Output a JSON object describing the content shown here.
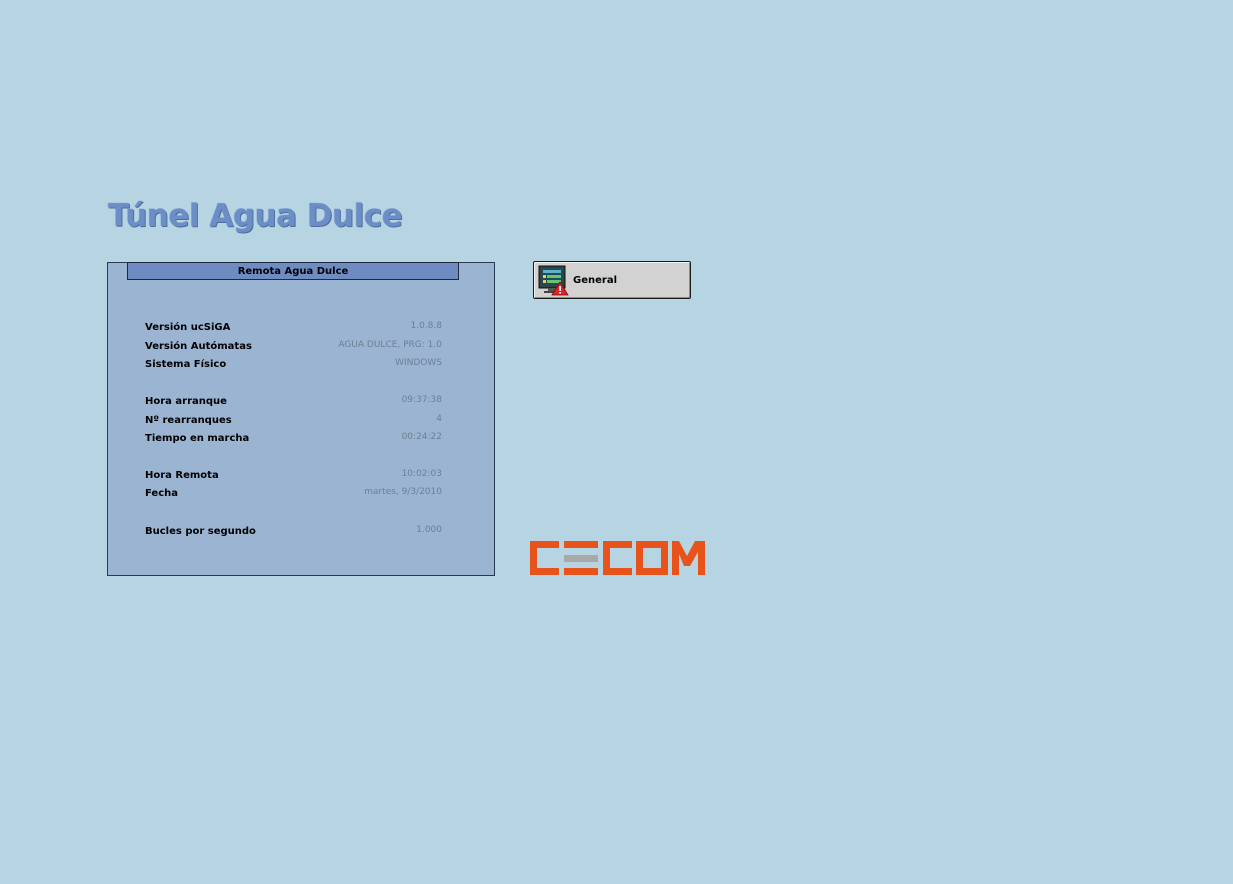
{
  "title": "Túnel Agua Dulce",
  "panel": {
    "header": "Remota Agua Dulce",
    "rows": [
      {
        "label": "Versión ucSiGA",
        "value": "1.0.8.8"
      },
      {
        "label": "Versión Autómatas",
        "value": "AGUA DULCE, PRG: 1.0"
      },
      {
        "label": "Sistema Físico",
        "value": "WINDOWS"
      },
      {
        "label": "Hora arranque",
        "value": "09:37:38"
      },
      {
        "label": "Nº rearranques",
        "value": "4"
      },
      {
        "label": "Tiempo en marcha",
        "value": "00:24:22"
      },
      {
        "label": "Hora Remota",
        "value": "10:02:03"
      },
      {
        "label": "Fecha",
        "value": "martes, 9/3/2010"
      },
      {
        "label": "Bucles por segundo",
        "value": "1.000"
      }
    ]
  },
  "general_button": {
    "label": "General",
    "icon": "monitor-warning-icon"
  },
  "logo": {
    "text": "CECOM",
    "color": "#e8531b"
  },
  "colors": {
    "background": "#b6d4e2",
    "panel": "#9ab4d2",
    "panel_header": "#6f8cc2",
    "title": "#6b8ec6",
    "value_text": "#6f7f92"
  }
}
